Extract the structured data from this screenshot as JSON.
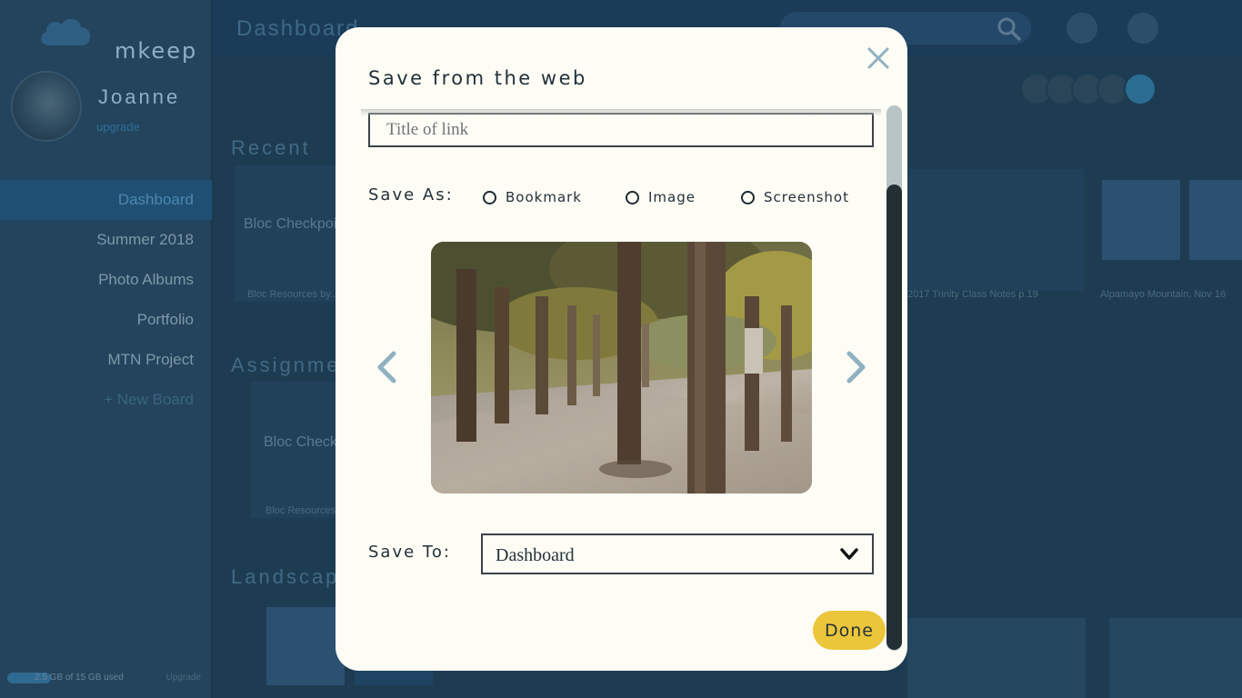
{
  "app": {
    "logo_text": "mkeep",
    "user": {
      "name": "Joanne",
      "status": "upgrade"
    },
    "nav": [
      "Dashboard",
      "Summer 2018",
      "Photo Albums",
      "Portfolio",
      "MTN Project",
      "+ New Board"
    ],
    "storage": {
      "used": "2.5 GB of 15 GB used",
      "upgrade": "Upgrade"
    },
    "page_title": "Dashboard",
    "sections": {
      "recent": "Recent",
      "assignments": "Assignments",
      "landscapes": "Landscapes"
    },
    "cards": {
      "recent_1_title": "Bloc Checkpoints",
      "recent_1_caption": "Bloc Resources by...",
      "notes_caption": "2017 Trinity Class Notes p.19",
      "mountain_caption": "Alpamayo Mountain, Nov 16",
      "assign_1_title": "Bloc Checkpoints",
      "assign_1_caption": "Bloc Resources..."
    }
  },
  "modal": {
    "title": "Save from the web",
    "link_title_placeholder": "Title of link",
    "save_as_label": "Save As:",
    "save_as_options": [
      "Bookmark",
      "Image",
      "Screenshot"
    ],
    "save_to_label": "Save To:",
    "save_to_value": "Dashboard",
    "done_label": "Done"
  },
  "colors": {
    "overlay_bg": "#1d3c52",
    "modal_bg": "#fdfcf5",
    "done_button": "#ecc63a",
    "arrow": "#8fb1c1",
    "scroll_thumb": "#232f33"
  },
  "icons": [
    "cloud-logo-icon",
    "search-icon",
    "add-icon",
    "layout-icon",
    "help-icon",
    "close-icon",
    "chevron-left-icon",
    "chevron-right-icon",
    "chevron-down-icon"
  ]
}
